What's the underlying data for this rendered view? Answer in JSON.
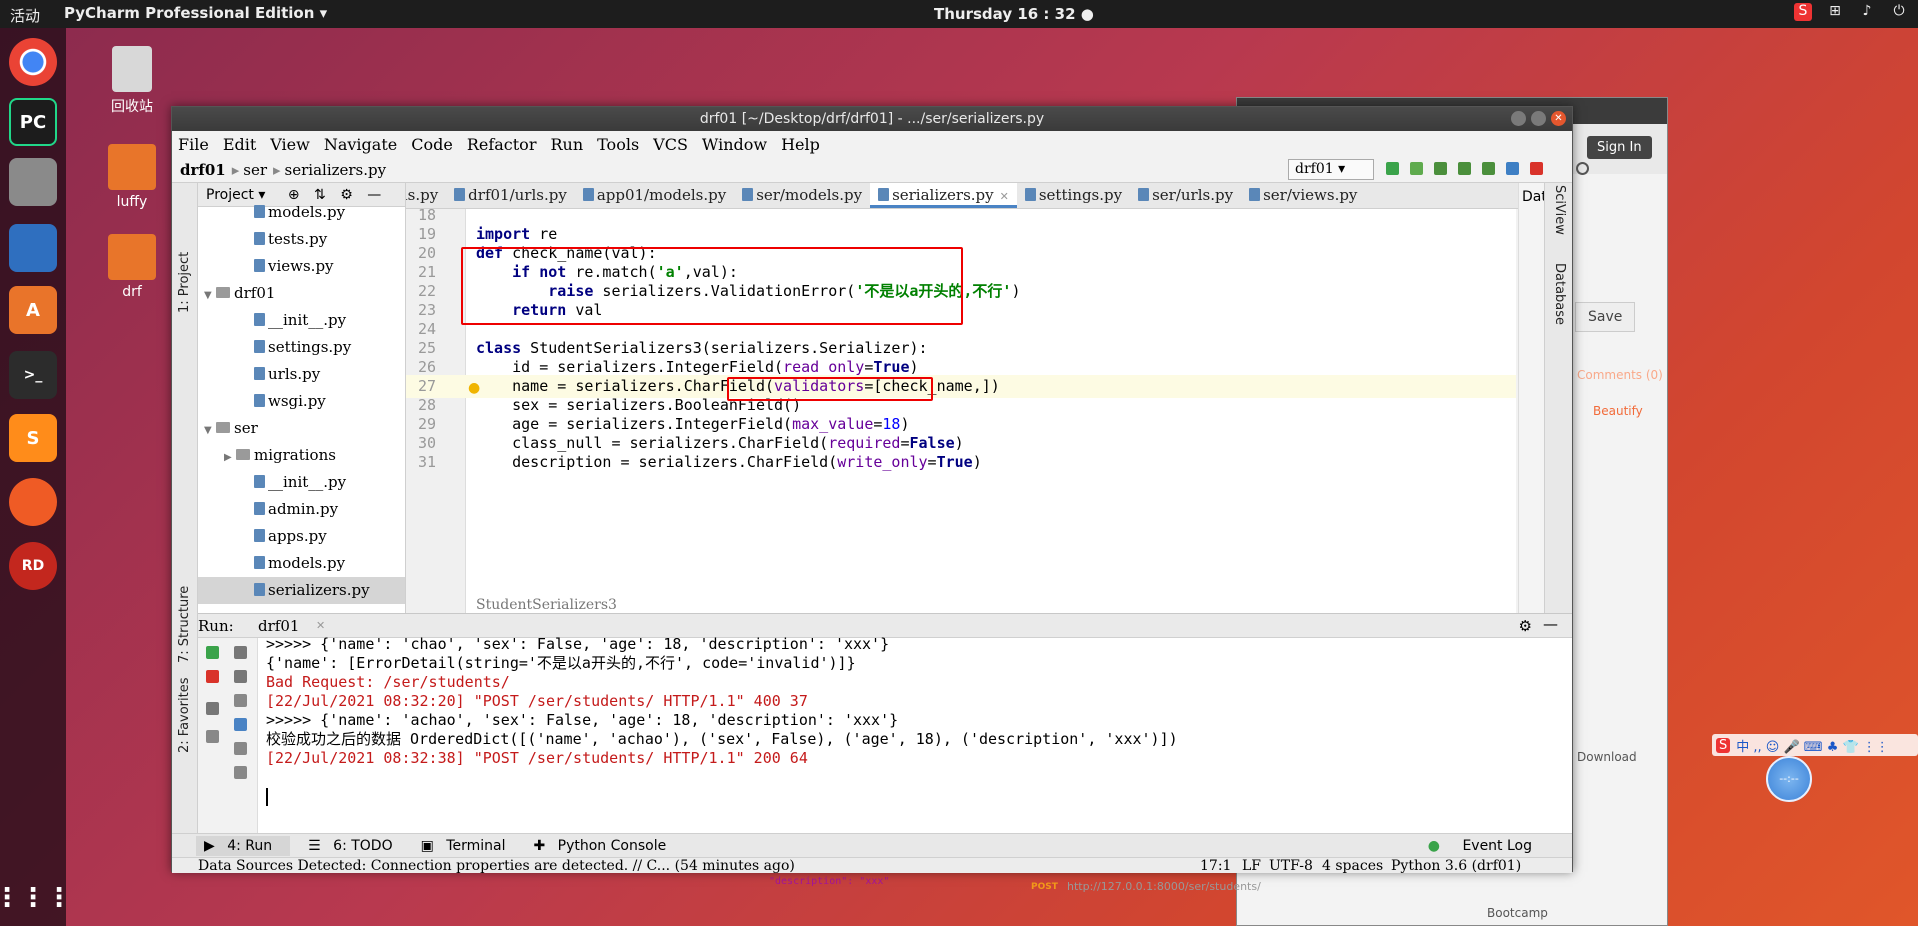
{
  "topbar": {
    "activities": "活动",
    "app": "PyCharm Professional Edition ▾",
    "clock": "Thursday 16 : 32 ●"
  },
  "desktop": {
    "trash": "回收站",
    "luffy": "luffy",
    "drf": "drf"
  },
  "window": {
    "title": "drf01 [~/Desktop/drf/drf01] - .../ser/serializers.py"
  },
  "menu": [
    "File",
    "Edit",
    "View",
    "Navigate",
    "Code",
    "Refactor",
    "Run",
    "Tools",
    "VCS",
    "Window",
    "Help"
  ],
  "nav": {
    "crumbs": [
      "drf01",
      "ser",
      "serializers.py"
    ],
    "run_config": "drf01 ▾"
  },
  "project": {
    "header": "Project ▾",
    "items": [
      {
        "label": "models.py",
        "type": "file",
        "indent": 56
      },
      {
        "label": "tests.py",
        "type": "file",
        "indent": 56
      },
      {
        "label": "views.py",
        "type": "file",
        "indent": 56
      },
      {
        "label": "drf01",
        "type": "dir",
        "indent": 20,
        "arrow": "▼"
      },
      {
        "label": "__init__.py",
        "type": "file",
        "indent": 56
      },
      {
        "label": "settings.py",
        "type": "file",
        "indent": 56
      },
      {
        "label": "urls.py",
        "type": "file",
        "indent": 56
      },
      {
        "label": "wsgi.py",
        "type": "file",
        "indent": 56
      },
      {
        "label": "ser",
        "type": "dir",
        "indent": 20,
        "arrow": "▼"
      },
      {
        "label": "migrations",
        "type": "dir",
        "indent": 40,
        "arrow": "▶"
      },
      {
        "label": "__init__.py",
        "type": "file",
        "indent": 56
      },
      {
        "label": "admin.py",
        "type": "file",
        "indent": 56
      },
      {
        "label": "apps.py",
        "type": "file",
        "indent": 56
      },
      {
        "label": "models.py",
        "type": "file",
        "indent": 56
      },
      {
        "label": "serializers.py",
        "type": "file",
        "indent": 56,
        "selected": true
      }
    ]
  },
  "tabs": [
    {
      "label": "urls.py",
      "active": false
    },
    {
      "label": "drf01/urls.py",
      "active": false
    },
    {
      "label": "app01/models.py",
      "active": false
    },
    {
      "label": "ser/models.py",
      "active": false
    },
    {
      "label": "serializers.py",
      "active": true
    },
    {
      "label": "settings.py",
      "active": false
    },
    {
      "label": "ser/urls.py",
      "active": false
    },
    {
      "label": "ser/views.py",
      "active": false
    }
  ],
  "editor": {
    "breadcrumb": "StudentSerializers3",
    "line_numbers": [
      "18",
      "19",
      "20",
      "21",
      "22",
      "23",
      "24",
      "25",
      "26",
      "27",
      "28",
      "29",
      "30",
      "31"
    ]
  },
  "right_stripe": {
    "dat": "Dat",
    "sciview": "SciView",
    "database": "Database"
  },
  "run": {
    "label": "Run:",
    "config": "drf01",
    "output": [
      {
        "text": ">>>>> {'name': 'chao', 'sex': False, 'age': 18, 'description': 'xxx'}",
        "red": false
      },
      {
        "text": "{'name': [ErrorDetail(string='不是以a开头的,不行', code='invalid')]}",
        "red": false
      },
      {
        "text": "Bad Request: /ser/students/",
        "red": true
      },
      {
        "text": "[22/Jul/2021 08:32:20] \"POST /ser/students/ HTTP/1.1\" 400 37",
        "red": true
      },
      {
        "text": ">>>>> {'name': 'achao', 'sex': False, 'age': 18, 'description': 'xxx'}",
        "red": false
      },
      {
        "text": "校验成功之后的数据 OrderedDict([('name', 'achao'), ('sex', False), ('age', 18), ('description', 'xxx')])",
        "red": false
      },
      {
        "text": "[22/Jul/2021 08:32:38] \"POST /ser/students/ HTTP/1.1\" 200 64",
        "red": true
      }
    ]
  },
  "side_tabs": {
    "project": "1: Project",
    "structure": "7: Structure",
    "favorites": "2: Favorites"
  },
  "bottom_tabs": {
    "run": "4: Run",
    "todo": "6: TODO",
    "terminal": "Terminal",
    "console": "Python Console",
    "event": "Event Log"
  },
  "status": {
    "message": "Data Sources Detected: Connection properties are detected. // C... (54 minutes ago)",
    "pos": "17:1",
    "lf": "LF",
    "enc": "UTF-8",
    "indent": "4 spaces",
    "interp": "Python 3.6 (drf01)"
  },
  "bgwin": {
    "signin": "Sign In",
    "save": "Save",
    "comments": "Comments (0)",
    "beautify": "Beautify",
    "download": "Download",
    "url": "http://127.0.0.1:8000/ser/students/",
    "post": "POST",
    "bootcamp": "Bootcamp",
    "json_line": "\"description\": \"xxx\""
  },
  "ime": {
    "label": "中 ,, ☺ 🎤 ⌨ ♣ 👕 ⋮⋮"
  },
  "floatball": "--:--",
  "colors": {
    "accent": "#4a83c4",
    "error": "#c41a1a",
    "highlight_box": "#e00000"
  }
}
